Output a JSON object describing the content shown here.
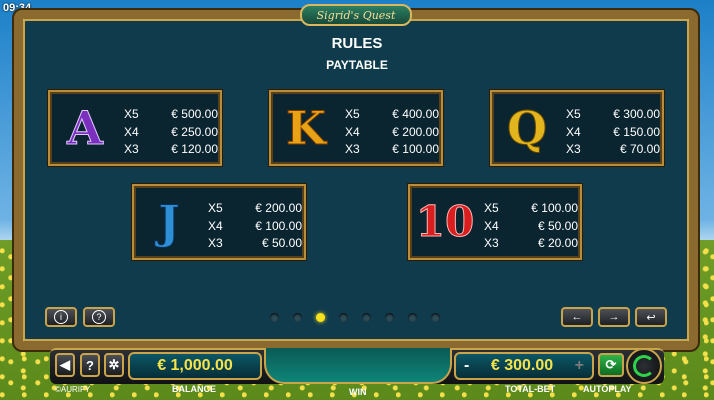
{
  "clock": "09:34",
  "game_logo": "Sigrid's Quest",
  "title": "RULES",
  "subtitle": "PAYTABLE",
  "symbols": [
    {
      "symbol": "A",
      "color": "#7b2fbf",
      "pays": [
        {
          "mult": "X5",
          "amount": "€ 500.00"
        },
        {
          "mult": "X4",
          "amount": "€ 250.00"
        },
        {
          "mult": "X3",
          "amount": "€ 120.00"
        }
      ]
    },
    {
      "symbol": "K",
      "color": "#e8a215",
      "pays": [
        {
          "mult": "X5",
          "amount": "€ 400.00"
        },
        {
          "mult": "X4",
          "amount": "€ 200.00"
        },
        {
          "mult": "X3",
          "amount": "€ 100.00"
        }
      ]
    },
    {
      "symbol": "Q",
      "color": "#e2b51e",
      "pays": [
        {
          "mult": "X5",
          "amount": "€ 300.00"
        },
        {
          "mult": "X4",
          "amount": "€ 150.00"
        },
        {
          "mult": "X3",
          "amount": "€ 70.00"
        }
      ]
    },
    {
      "symbol": "J",
      "color": "#2f8fd6",
      "pays": [
        {
          "mult": "X5",
          "amount": "€ 200.00"
        },
        {
          "mult": "X4",
          "amount": "€ 100.00"
        },
        {
          "mult": "X3",
          "amount": "€ 50.00"
        }
      ]
    },
    {
      "symbol": "10",
      "color": "#d81e1e",
      "pays": [
        {
          "mult": "X5",
          "amount": "€ 100.00"
        },
        {
          "mult": "X4",
          "amount": "€ 50.00"
        },
        {
          "mult": "X3",
          "amount": "€ 20.00"
        }
      ]
    }
  ],
  "nav": {
    "info_icon": "i",
    "help_icon": "?",
    "prev_icon": "←",
    "next_icon": "→",
    "back_icon": "↩"
  },
  "pagination": {
    "total": 8,
    "active": 3
  },
  "bottom": {
    "balance_value": "€ 1,000.00",
    "balance_label": "BALANCE",
    "win_label": "WIN",
    "bet_value": "€ 300.00",
    "bet_label": "TOTAL-BET",
    "bet_minus": "-",
    "bet_plus": "+",
    "autoplay_label": "AUTOPLAY",
    "brand": "©AURIFY"
  }
}
